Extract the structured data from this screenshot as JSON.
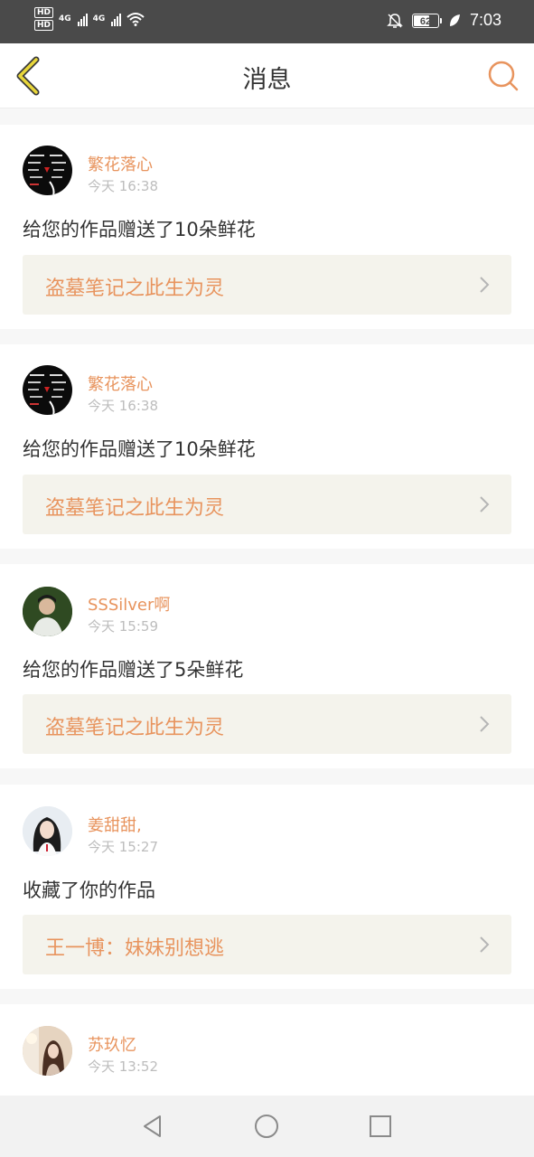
{
  "status_bar": {
    "hd1": "HD",
    "hd2": "HD",
    "net1": "4G",
    "net2": "4G",
    "battery": "62",
    "time": "7:03",
    "icons": [
      "hd-icon",
      "signal-icon",
      "wifi-icon",
      "mute-icon",
      "battery-icon",
      "leaf-icon"
    ]
  },
  "header": {
    "title": "消息",
    "back_icon": "chevron-left-icon",
    "search_icon": "search-icon",
    "accent_color": "#e8945e"
  },
  "messages": [
    {
      "user": "繁花落心",
      "time": "今天 16:38",
      "text": "给您的作品赠送了10朵鲜花",
      "work": "盗墓笔记之此生为灵"
    },
    {
      "user": "繁花落心",
      "time": "今天 16:38",
      "text": "给您的作品赠送了10朵鲜花",
      "work": "盗墓笔记之此生为灵"
    },
    {
      "user": "SSSilver啊",
      "time": "今天 15:59",
      "text": "给您的作品赠送了5朵鲜花",
      "work": "盗墓笔记之此生为灵"
    },
    {
      "user": "姜甜甜,",
      "time": "今天 15:27",
      "text": "收藏了你的作品",
      "work": "王一博：妹妹别想逃"
    },
    {
      "user": "苏玖忆",
      "time": "今天 13:52"
    }
  ],
  "nav": {
    "icons": [
      "back-triangle-icon",
      "home-circle-icon",
      "recent-square-icon"
    ]
  }
}
